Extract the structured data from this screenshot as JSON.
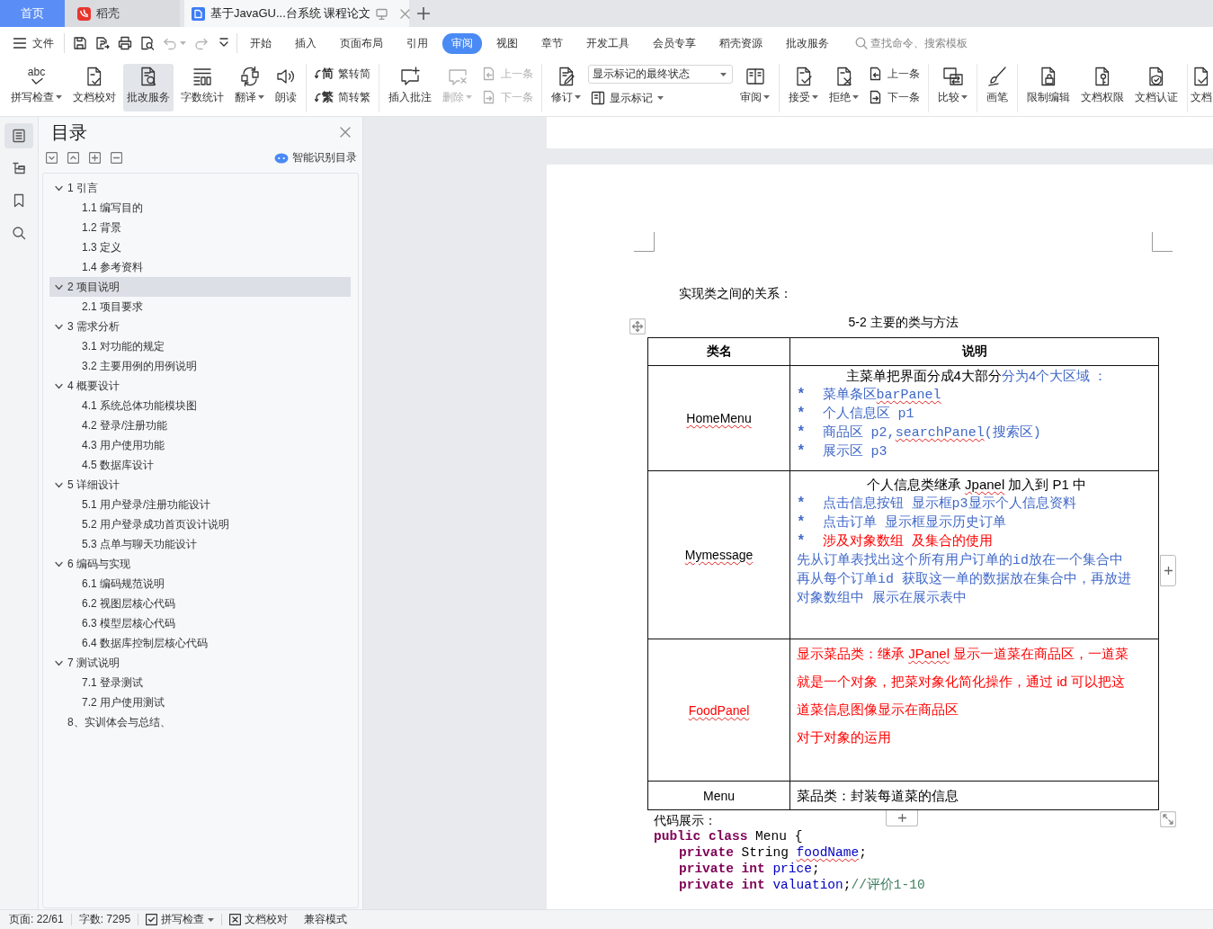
{
  "tabs": [
    {
      "kind": "home",
      "label": "首页",
      "selected": false
    },
    {
      "kind": "app",
      "label": "稻壳",
      "selected": false
    },
    {
      "kind": "document",
      "label": "基于JavaGU...台系统 课程论文",
      "selected": true
    }
  ],
  "menu": {
    "file": "文件",
    "quick_access": [
      {
        "kind": "save",
        "disabled": false,
        "dropdown": false
      },
      {
        "kind": "export",
        "disabled": false,
        "dropdown": false
      },
      {
        "kind": "print",
        "disabled": false,
        "dropdown": false
      },
      {
        "kind": "preview",
        "disabled": false,
        "dropdown": false
      },
      {
        "kind": "undo",
        "disabled": true,
        "dropdown": true
      },
      {
        "kind": "redo",
        "disabled": true,
        "dropdown": false
      },
      {
        "kind": "more",
        "disabled": false,
        "dropdown": false
      }
    ],
    "tabs": [
      {
        "label": "开始",
        "selected": false
      },
      {
        "label": "插入",
        "selected": false
      },
      {
        "label": "页面布局",
        "selected": false
      },
      {
        "label": "引用",
        "selected": false
      },
      {
        "label": "审阅",
        "selected": true
      },
      {
        "label": "视图",
        "selected": false
      },
      {
        "label": "章节",
        "selected": false
      },
      {
        "label": "开发工具",
        "selected": false
      },
      {
        "label": "会员专享",
        "selected": false
      },
      {
        "label": "稻壳资源",
        "selected": false
      },
      {
        "label": "批改服务",
        "selected": false
      }
    ],
    "search": {
      "placeholder": "查找命令、搜索模板"
    }
  },
  "ribbon": [
    [
      {
        "kind": "large",
        "label": "拼写检查",
        "glyph": "abc",
        "dropdown": true,
        "disabled": false,
        "highlighted": false
      },
      {
        "kind": "large",
        "label": "文档校对",
        "dropdown": false,
        "disabled": false,
        "highlighted": false
      },
      {
        "kind": "large",
        "label": "批改服务",
        "dropdown": false,
        "disabled": false,
        "highlighted": true
      },
      {
        "kind": "large",
        "label": "字数统计",
        "dropdown": false,
        "disabled": false,
        "highlighted": false
      },
      {
        "kind": "large",
        "label": "翻译",
        "dropdown": true,
        "disabled": false,
        "highlighted": false
      },
      {
        "kind": "large",
        "label": "朗读",
        "dropdown": false,
        "disabled": false,
        "highlighted": false
      }
    ],
    [
      {
        "kind": "stack",
        "items": [
          {
            "kind": "small",
            "label": "繁转简",
            "glyph": "简",
            "dropdown": false,
            "disabled": false
          },
          {
            "kind": "small",
            "label": "简转繁",
            "glyph": "繁",
            "dropdown": false,
            "disabled": false
          }
        ]
      }
    ],
    [
      {
        "kind": "large",
        "label": "插入批注",
        "dropdown": false,
        "disabled": false,
        "highlighted": false
      },
      {
        "kind": "large",
        "label": "删除",
        "dropdown": true,
        "disabled": true,
        "highlighted": false
      },
      {
        "kind": "stack",
        "items": [
          {
            "kind": "small",
            "label": "上一条",
            "dropdown": false,
            "disabled": true
          },
          {
            "kind": "small",
            "label": "下一条",
            "dropdown": false,
            "disabled": true
          }
        ]
      }
    ],
    [
      {
        "kind": "large",
        "label": "修订",
        "dropdown": true,
        "disabled": false,
        "highlighted": false
      },
      {
        "kind": "stack",
        "items": [
          {
            "kind": "select",
            "value": "显示标记的最终状态"
          },
          {
            "kind": "small",
            "label": "显示标记",
            "dropdown": true,
            "disabled": false
          }
        ]
      },
      {
        "kind": "large",
        "label": "审阅",
        "dropdown": true,
        "disabled": false,
        "highlighted": false
      }
    ],
    [
      {
        "kind": "large",
        "label": "接受",
        "dropdown": true,
        "disabled": false,
        "highlighted": false
      },
      {
        "kind": "large",
        "label": "拒绝",
        "dropdown": true,
        "disabled": false,
        "highlighted": false
      },
      {
        "kind": "stack",
        "items": [
          {
            "kind": "small",
            "label": "上一条",
            "dropdown": false,
            "disabled": false
          },
          {
            "kind": "small",
            "label": "下一条",
            "dropdown": false,
            "disabled": false
          }
        ]
      }
    ],
    [
      {
        "kind": "large",
        "label": "比较",
        "dropdown": true,
        "disabled": false,
        "highlighted": false
      }
    ],
    [
      {
        "kind": "large",
        "label": "画笔",
        "dropdown": false,
        "disabled": false,
        "highlighted": false
      }
    ],
    [
      {
        "kind": "large",
        "label": "限制编辑",
        "dropdown": false,
        "disabled": false,
        "highlighted": false
      },
      {
        "kind": "large",
        "label": "文档权限",
        "dropdown": false,
        "disabled": false,
        "highlighted": false
      },
      {
        "kind": "large",
        "label": "文档认证",
        "dropdown": false,
        "disabled": false,
        "highlighted": false
      }
    ],
    [
      {
        "kind": "large",
        "label": "文档",
        "dropdown": false,
        "disabled": false,
        "highlighted": false
      }
    ]
  ],
  "rail": [
    {
      "selected": true
    },
    {
      "selected": false
    },
    {
      "selected": false
    },
    {
      "selected": false
    }
  ],
  "toc": {
    "title": "目录",
    "smart_button": "智能识别目录",
    "items": [
      {
        "label": "1 引言",
        "expanded": true,
        "selected": false,
        "children": [
          {
            "label": "1.1 编写目的",
            "selected": false
          },
          {
            "label": "1.2 背景",
            "selected": false
          },
          {
            "label": "1.3 定义",
            "selected": false
          },
          {
            "label": "1.4 参考资料",
            "selected": false
          }
        ]
      },
      {
        "label": "2 项目说明",
        "expanded": true,
        "selected": true,
        "children": [
          {
            "label": "2.1 项目要求",
            "selected": false
          }
        ]
      },
      {
        "label": "3 需求分析",
        "expanded": true,
        "selected": false,
        "children": [
          {
            "label": "3.1 对功能的规定",
            "selected": false
          },
          {
            "label": "3.2 主要用例的用例说明",
            "selected": false
          }
        ]
      },
      {
        "label": "4 概要设计",
        "expanded": true,
        "selected": false,
        "children": [
          {
            "label": "4.1 系统总体功能模块图",
            "selected": false
          },
          {
            "label": "4.2 登录/注册功能",
            "selected": false
          },
          {
            "label": "4.3 用户使用功能",
            "selected": false
          },
          {
            "label": "4.5 数据库设计",
            "selected": false
          }
        ]
      },
      {
        "label": "5 详细设计",
        "expanded": true,
        "selected": false,
        "children": [
          {
            "label": "5.1 用户登录/注册功能设计",
            "selected": false
          },
          {
            "label": "5.2 用户登录成功首页设计说明",
            "selected": false
          },
          {
            "label": "5.3 点单与聊天功能设计",
            "selected": false
          }
        ]
      },
      {
        "label": "6 编码与实现",
        "expanded": true,
        "selected": false,
        "children": [
          {
            "label": "6.1 编码规范说明",
            "selected": false
          },
          {
            "label": "6.2 视图层核心代码",
            "selected": false
          },
          {
            "label": "6.3 模型层核心代码",
            "selected": false
          },
          {
            "label": "6.4 数据库控制层核心代码",
            "selected": false
          }
        ]
      },
      {
        "label": "7 测试说明",
        "expanded": true,
        "selected": false,
        "children": [
          {
            "label": "7.1 登录测试",
            "selected": false
          },
          {
            "label": "7.2 用户使用测试",
            "selected": false
          }
        ]
      },
      {
        "label": "8、实训体会与总结、",
        "selected": false
      }
    ]
  },
  "document": {
    "intro": "实现类之间的关系：",
    "table": {
      "caption": "5-2 主要的类与方法",
      "columns": [
        "类名",
        "说明"
      ],
      "rows": [
        {
          "class_name": {
            "text": "HomeMenu",
            "color": "#000000",
            "misspelled": true
          },
          "lines": [
            {
              "kind": "heading",
              "segments": [
                {
                  "text": "主菜单把界面分成4大部分",
                  "color": "#000000",
                  "misspelled": false
                },
                {
                  "text": "分为4个大区域 ：",
                  "color": "#4169c8",
                  "misspelled": false
                }
              ]
            },
            {
              "kind": "bullet",
              "marker": {
                "text": "*",
                "color": "#4169c8"
              },
              "segments": [
                {
                  "text": "菜单条区",
                  "color": "#4169c8",
                  "misspelled": false
                },
                {
                  "text": "barPanel",
                  "color": "#4169c8",
                  "misspelled": true
                }
              ]
            },
            {
              "kind": "bullet",
              "marker": {
                "text": "*",
                "color": "#4169c8"
              },
              "segments": [
                {
                  "text": "个人信息区 p1",
                  "color": "#4169c8",
                  "misspelled": false
                }
              ]
            },
            {
              "kind": "bullet",
              "marker": {
                "text": "*",
                "color": "#4169c8"
              },
              "segments": [
                {
                  "text": "商品区 p2,",
                  "color": "#4169c8",
                  "misspelled": false
                },
                {
                  "text": "searchPanel",
                  "color": "#4169c8",
                  "misspelled": true
                },
                {
                  "text": "(搜索区)",
                  "color": "#4169c8",
                  "misspelled": false
                }
              ]
            },
            {
              "kind": "bullet",
              "marker": {
                "text": "*",
                "color": "#4169c8"
              },
              "segments": [
                {
                  "text": "展示区 p3",
                  "color": "#4169c8",
                  "misspelled": false
                }
              ]
            }
          ]
        },
        {
          "class_name": {
            "text": "Mymessage",
            "color": "#000000",
            "misspelled": true
          },
          "lines": [
            {
              "kind": "heading",
              "segments": [
                {
                  "text": "个人信息类继承 ",
                  "color": "#000000",
                  "misspelled": false
                },
                {
                  "text": "Jpanel",
                  "color": "#000000",
                  "misspelled": true
                },
                {
                  "text": " 加入到 P1 中",
                  "color": "#000000",
                  "misspelled": false
                }
              ]
            },
            {
              "kind": "bullet",
              "marker": {
                "text": "*",
                "color": "#4169c8"
              },
              "segments": [
                {
                  "text": "点击信息按钮  显示框p3显示个人信息资料",
                  "color": "#4169c8",
                  "misspelled": false
                }
              ]
            },
            {
              "kind": "bullet",
              "marker": {
                "text": "*",
                "color": "#4169c8"
              },
              "segments": [
                {
                  "text": "点击订单  显示框显示历史订单",
                  "color": "#4169c8",
                  "misspelled": false
                }
              ]
            },
            {
              "kind": "bullet",
              "marker": {
                "text": "*",
                "color": "#4169c8"
              },
              "segments": [
                {
                  "text": "涉及对象数组  及集合的使用",
                  "color": "#ff0000",
                  "misspelled": false
                }
              ]
            },
            {
              "kind": "note",
              "segments": [
                {
                  "text": "先从订单表找出这个所有用户订单的id放在一个集合中",
                  "color": "#4169c8",
                  "misspelled": false
                }
              ]
            },
            {
              "kind": "note",
              "segments": [
                {
                  "text": "再从每个订单id  获取这一单的数据放在集合中，再放进",
                  "color": "#4169c8",
                  "misspelled": false
                }
              ]
            },
            {
              "kind": "note",
              "segments": [
                {
                  "text": "对象数组中  展示在展示表中",
                  "color": "#4169c8",
                  "misspelled": false
                }
              ]
            }
          ]
        },
        {
          "class_name": {
            "text": "FoodPanel",
            "color": "#ff0000",
            "misspelled": true
          },
          "lines": [
            {
              "kind": "text",
              "segments": [
                {
                  "text": "显示菜品类：继承 ",
                  "color": "#ff0000",
                  "misspelled": false
                },
                {
                  "text": "JPanel",
                  "color": "#ff0000",
                  "misspelled": true
                },
                {
                  "text": " 显示一道菜在商品区，一道菜",
                  "color": "#ff0000",
                  "misspelled": false
                }
              ]
            },
            {
              "kind": "text",
              "segments": [
                {
                  "text": "就是一个对象，把菜对象化简化操作，通过 id 可以把这",
                  "color": "#ff0000",
                  "misspelled": false
                }
              ]
            },
            {
              "kind": "text",
              "segments": [
                {
                  "text": "道菜信息图像显示在商品区",
                  "color": "#ff0000",
                  "misspelled": false
                }
              ]
            },
            {
              "kind": "text",
              "segments": [
                {
                  "text": "对于对象的运用",
                  "color": "#ff0000",
                  "misspelled": false
                }
              ]
            }
          ]
        },
        {
          "class_name": {
            "text": "Menu",
            "color": "#000000",
            "misspelled": false
          },
          "lines": [
            {
              "kind": "text",
              "segments": [
                {
                  "text": "菜品类：封装每道菜的信息",
                  "color": "#000000",
                  "misspelled": false
                }
              ]
            }
          ]
        }
      ]
    },
    "code_title": "代码展示：",
    "code": [
      {
        "tokens": [
          {
            "kind": "keyword",
            "text": "public class",
            "misspelled": false
          },
          {
            "kind": "plain",
            "text": " Menu {",
            "misspelled": false
          }
        ],
        "children": [
          {
            "tokens": [
              {
                "kind": "keyword",
                "text": "private",
                "misspelled": false
              },
              {
                "kind": "plain",
                "text": " String ",
                "misspelled": false
              },
              {
                "kind": "field",
                "text": "foodName",
                "misspelled": true
              },
              {
                "kind": "plain",
                "text": ";",
                "misspelled": false
              }
            ]
          },
          {
            "tokens": [
              {
                "kind": "keyword",
                "text": "private int ",
                "misspelled": false
              },
              {
                "kind": "field",
                "text": "price",
                "misspelled": false
              },
              {
                "kind": "plain",
                "text": ";",
                "misspelled": false
              }
            ]
          },
          {
            "tokens": [
              {
                "kind": "keyword",
                "text": "private int ",
                "misspelled": false
              },
              {
                "kind": "field",
                "text": "valuation",
                "misspelled": false
              },
              {
                "kind": "plain",
                "text": ";",
                "misspelled": false
              },
              {
                "kind": "comment",
                "text": "//评价1-10",
                "misspelled": false
              }
            ]
          }
        ]
      }
    ]
  },
  "status_bar": [
    {
      "kind": "text",
      "label": "页面: 22/61",
      "dropdown": false
    },
    {
      "kind": "text",
      "label": "字数: 7295",
      "dropdown": false
    },
    {
      "kind": "spellcheck",
      "label": "拼写检查",
      "dropdown": true
    },
    {
      "kind": "proofread",
      "label": "文档校对",
      "dropdown": false
    },
    {
      "kind": "text",
      "label": "兼容模式",
      "dropdown": false
    }
  ]
}
